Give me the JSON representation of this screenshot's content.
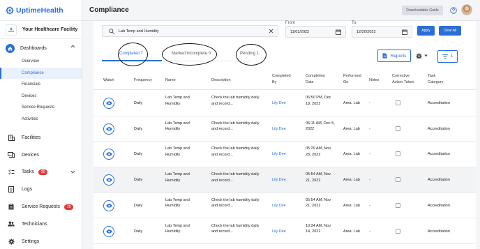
{
  "brand": {
    "name": "UptimeHealth",
    "color": "#2a6fd6"
  },
  "facility": {
    "name": "Your Healthcare Facility"
  },
  "sidebar": {
    "dashboards": {
      "label": "Dashboards"
    },
    "sub_items": [
      {
        "label": "Overview",
        "active": false
      },
      {
        "label": "Compliance",
        "active": true
      },
      {
        "label": "Financials",
        "active": false
      },
      {
        "label": "Devices",
        "active": false
      },
      {
        "label": "Service Requests",
        "active": false
      },
      {
        "label": "Activities",
        "active": false
      }
    ],
    "items": [
      {
        "label": "Facilities",
        "icon": "building-icon"
      },
      {
        "label": "Devices",
        "icon": "device-icon"
      },
      {
        "label": "Tasks",
        "icon": "tasks-icon",
        "badge": "20"
      },
      {
        "label": "Logs",
        "icon": "logs-icon"
      },
      {
        "label": "Service Requests",
        "icon": "clipboard-icon",
        "badge": "19"
      },
      {
        "label": "Technicians",
        "icon": "people-icon"
      },
      {
        "label": "Settings",
        "icon": "gear-icon"
      }
    ]
  },
  "header": {
    "title": "Compliance",
    "download_label": "Downloadable Guide"
  },
  "filters": {
    "search_value": "Lab Temp and Humidity",
    "from_label": "From",
    "from_value": "11/01/2022",
    "to_label": "To",
    "to_value": "12/20/2022",
    "apply_label": "Apply",
    "clear_label": "Clear All"
  },
  "tabs": [
    {
      "label": "Completed 7",
      "active": true
    },
    {
      "label": "Marked Incomplete 0",
      "active": false
    },
    {
      "label": "Pending 1",
      "active": false
    }
  ],
  "toolbar": {
    "reports_label": "Reports",
    "filter_count": "1"
  },
  "table": {
    "headers": {
      "watch": "Watch",
      "frequency": "Frequency",
      "name": "Name",
      "description": "Description",
      "completed_by": [
        "Completed",
        "By"
      ],
      "completion_date": [
        "Completion",
        "Date"
      ],
      "performed_on": [
        "Performed",
        "On"
      ],
      "notes": "Notes",
      "corrective": [
        "Corrective",
        "Action Taken"
      ],
      "category": [
        "Task",
        "Category"
      ]
    },
    "rows": [
      {
        "frequency": "Daily",
        "name": [
          "Lab Temp and",
          "Humidity"
        ],
        "description": [
          "Check the lab humidity daily",
          "and record..."
        ],
        "completed_by": "Lily Dee",
        "date": [
          "06:50 PM, Dec",
          "18, 2022"
        ],
        "performed_on": "Area: Lab",
        "notes": "-",
        "category": "Accreditation"
      },
      {
        "frequency": "Daily",
        "name": [
          "Lab Temp and",
          "Humidity"
        ],
        "description": [
          "Check the lab humidity daily",
          "and record..."
        ],
        "completed_by": "Lily Dee",
        "date": [
          "06:11 AM, Dec 5,",
          "2022"
        ],
        "performed_on": "Area: Lab",
        "notes": "-",
        "category": "Accreditation"
      },
      {
        "frequency": "Daily",
        "name": [
          "Lab Temp and",
          "Humidity"
        ],
        "description": [
          "Check the lab humidity daily",
          "and record..."
        ],
        "completed_by": "Lily Dee",
        "date": [
          "05:29 AM, Nov",
          "28, 2022"
        ],
        "performed_on": "Area: Lab",
        "notes": "-",
        "category": "Accreditation"
      },
      {
        "frequency": "Daily",
        "name": [
          "Lab Temp and",
          "Humidity"
        ],
        "description": [
          "Check the lab humidity daily",
          "and record..."
        ],
        "completed_by": "Lily Dee",
        "date": [
          "05:54 AM, Nov",
          "21, 2022"
        ],
        "performed_on": "Area: Lab",
        "notes": "-",
        "category": "Accreditation"
      },
      {
        "frequency": "Daily",
        "name": [
          "Lab Temp and",
          "Humidity"
        ],
        "description": [
          "Check the lab humidity daily",
          "and record..."
        ],
        "completed_by": "Lily Dee",
        "date": [
          "05:54 AM, Nov",
          "21, 2022"
        ],
        "performed_on": "Area: Lab",
        "notes": "-",
        "category": "Accreditation"
      },
      {
        "frequency": "Daily",
        "name": [
          "Lab Temp and",
          "Humidity"
        ],
        "description": [
          "Check the lab humidity daily",
          "and record..."
        ],
        "completed_by": "Lily Dee",
        "date": [
          "10:34 AM, Nov",
          "14, 2022"
        ],
        "performed_on": "Area: Lab",
        "notes": "-",
        "category": "Accreditation"
      }
    ]
  }
}
